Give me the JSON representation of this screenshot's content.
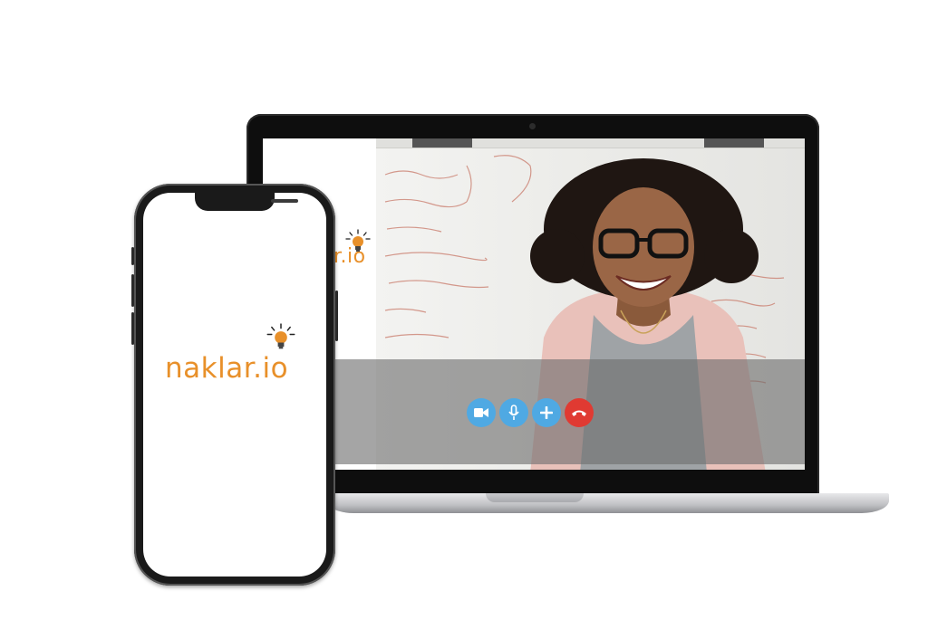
{
  "brand": {
    "name": "naklar.io",
    "screen_partial": "r.io",
    "color": "#e8902a"
  },
  "call_controls": {
    "video_icon": "video-camera-icon",
    "mic_icon": "microphone-icon",
    "add_icon": "plus-icon",
    "end_icon": "hang-up-icon",
    "primary_color": "#4fa9e3",
    "end_color": "#e03a32"
  }
}
